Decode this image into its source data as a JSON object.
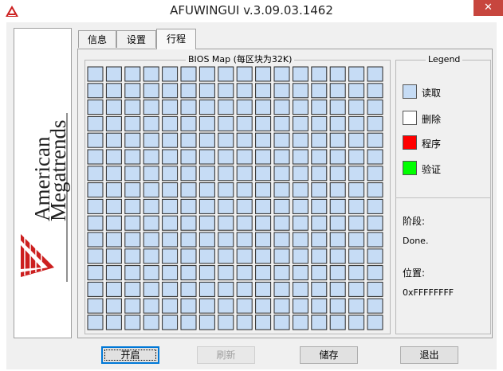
{
  "window": {
    "title": "AFUWINGUI v.3.09.03.1462",
    "close_glyph": "✕",
    "app_icon": "ami-logo-icon"
  },
  "logo": {
    "line1": "American",
    "line2": "Megatrends"
  },
  "tabs": [
    {
      "label": "信息",
      "active": false
    },
    {
      "label": "设置",
      "active": false
    },
    {
      "label": "行程",
      "active": true
    }
  ],
  "bios_map": {
    "title": "BIOS Map (每区块为32K)",
    "rows": 16,
    "cols": 16,
    "block_color": "#c6dcf5"
  },
  "legend": {
    "title": "Legend",
    "items": [
      {
        "label": "读取",
        "color": "#c6dcf5"
      },
      {
        "label": "删除",
        "color": "#ffffff"
      },
      {
        "label": "程序",
        "color": "#ff0000"
      },
      {
        "label": "验证",
        "color": "#00ff00"
      }
    ]
  },
  "status": {
    "phase_label": "阶段:",
    "phase_value": "Done.",
    "position_label": "位置:",
    "position_value": "0xFFFFFFFF"
  },
  "buttons": {
    "start": "开启",
    "refresh": "刷新",
    "save": "储存",
    "exit": "退出"
  },
  "colors": {
    "close_red": "#c7463e",
    "logo_red": "#cc1f1f",
    "logo_text": "#222222"
  }
}
